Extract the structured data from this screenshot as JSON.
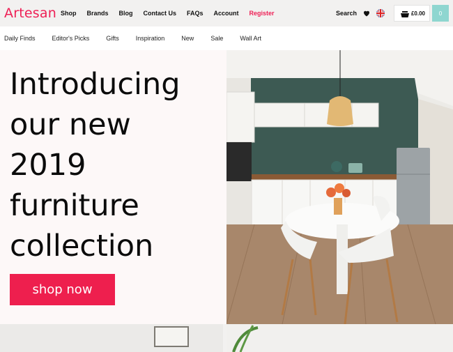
{
  "header": {
    "logo": "Artesan",
    "nav": [
      "Shop",
      "Brands",
      "Blog",
      "Contact Us",
      "FAQs",
      "Account",
      "Register"
    ],
    "search_label": "Search",
    "cart_total": "£0.00",
    "cart_count": "0"
  },
  "subnav": [
    "Daily Finds",
    "Editor's Picks",
    "Gifts",
    "Inspiration",
    "New",
    "Sale",
    "Wall Art"
  ],
  "hero": {
    "headline_lines": [
      "Introducing",
      "our new",
      "2019",
      "furniture",
      "collection"
    ],
    "cta_label": "shop now"
  },
  "icons": {
    "heart": "heart-icon",
    "flag": "uk-flag-icon",
    "cart": "basket-icon"
  },
  "colors": {
    "brand": "#ee1f55",
    "cta": "#ee1f4e",
    "cart_count_bg": "#8fd6d0"
  }
}
